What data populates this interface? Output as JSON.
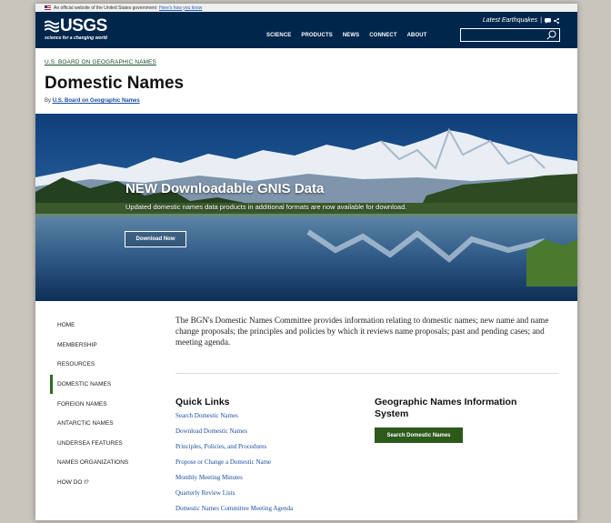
{
  "gov_banner": {
    "text": "An official website of the United States government",
    "link": "Here's how you know"
  },
  "header": {
    "logo": "USGS",
    "tagline": "science for a changing world",
    "nav": [
      "SCIENCE",
      "PRODUCTS",
      "NEWS",
      "CONNECT",
      "ABOUT"
    ],
    "quake_link": "Latest Earthquakes",
    "search_placeholder": ""
  },
  "breadcrumb": "U.S. BOARD ON GEOGRAPHIC NAMES",
  "page_title": "Domestic Names",
  "byline": {
    "prefix": "By",
    "link": "U.S. Board on Geographic Names"
  },
  "hero": {
    "title": "NEW Downloadable GNIS Data",
    "text": "Updated domestic names data products in additional formats are now available for download.",
    "button": "Download Now"
  },
  "sidebar": {
    "items": [
      {
        "label": "HOME"
      },
      {
        "label": "MEMBERSHIP"
      },
      {
        "label": "RESOURCES"
      },
      {
        "label": "DOMESTIC NAMES"
      },
      {
        "label": "FOREIGN NAMES"
      },
      {
        "label": "ANTARCTIC NAMES"
      },
      {
        "label": "UNDERSEA FEATURES"
      },
      {
        "label": "NAMES ORGANIZATIONS"
      },
      {
        "label": "HOW DO I?"
      }
    ],
    "active_index": 3
  },
  "main": {
    "intro": "The BGN's Domestic Names Committee provides information relating to domestic names; new name and name change proposals; the principles and policies by which it reviews name proposals; past and pending cases; and meeting agenda.",
    "quick_links_title": "Quick Links",
    "quick_links": [
      "Search Domestic Names",
      "Download Domestic Names",
      "Principles, Policies, and Procedures",
      "Propose or Change a Domestic Name",
      "Monthly Meeting Minutes",
      "Quarterly Review Lists",
      "Domestic Names Committee Meeting Agenda"
    ],
    "gnis_title": "Geographic Names Information System",
    "gnis_button": "Search Domestic Names"
  },
  "colors": {
    "header_bg": "#00264c",
    "accent_green": "#2c5a1a",
    "link_blue": "#1a4d9e"
  }
}
